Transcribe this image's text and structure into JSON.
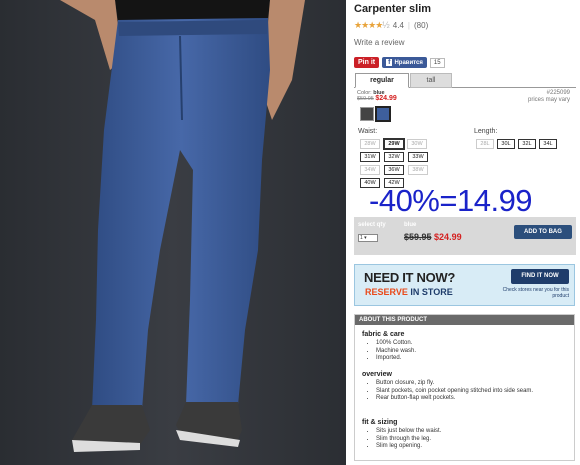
{
  "product": {
    "title": "Carpenter slim",
    "stars": "★★★★",
    "half_star": "½",
    "rating": "4.4",
    "reviews": "(80)",
    "write_review": "Write a review"
  },
  "social": {
    "pin": "Pin it",
    "fb_label": "Нравится",
    "fb_count": "15"
  },
  "tabs": [
    "regular",
    "tall"
  ],
  "sku": "#225099",
  "price_note": "prices may vary",
  "color": {
    "label": "Color:",
    "name": "blue",
    "was": "$59.95",
    "now": "$24.99"
  },
  "waist": {
    "label": "Waist:",
    "sizes": [
      "28W",
      "29W",
      "30W",
      "31W",
      "32W",
      "33W",
      "34W",
      "36W",
      "38W",
      "40W",
      "42W"
    ]
  },
  "length": {
    "label": "Length:",
    "sizes": [
      "28L",
      "30L",
      "32L",
      "34L"
    ]
  },
  "overlay_text": "-40%=14.99",
  "cart": {
    "qty_label": "select qty",
    "qty_value": "1",
    "color_label": "blue",
    "was": "$59.95",
    "now": "$24.99",
    "button": "ADD TO BAG"
  },
  "store": {
    "need": "NEED IT",
    "now": "NOW?",
    "reserve": "RESERVE",
    "in_store": "IN STORE",
    "button": "FIND IT NOW",
    "check": "Check stores near you for this product"
  },
  "about": {
    "heading": "ABOUT THIS PRODUCT",
    "fabric_title": "fabric & care",
    "fabric": [
      "100% Cotton.",
      "Machine wash.",
      "Imported."
    ],
    "overview_title": "overview",
    "overview": [
      "Button closure, zip fly.",
      "Slant pockets, coin pocket opening stitched into side seam.",
      "Rear button-flap welt pockets."
    ],
    "fit_title": "fit & sizing",
    "fit": [
      "Sits just below the waist.",
      "Slim through the leg.",
      "Slim leg opening."
    ]
  },
  "colors": {
    "accent": "#2c4f7c",
    "sale": "#d42020",
    "overlay": "#1a23c9",
    "pants": "#3d5c9a"
  }
}
